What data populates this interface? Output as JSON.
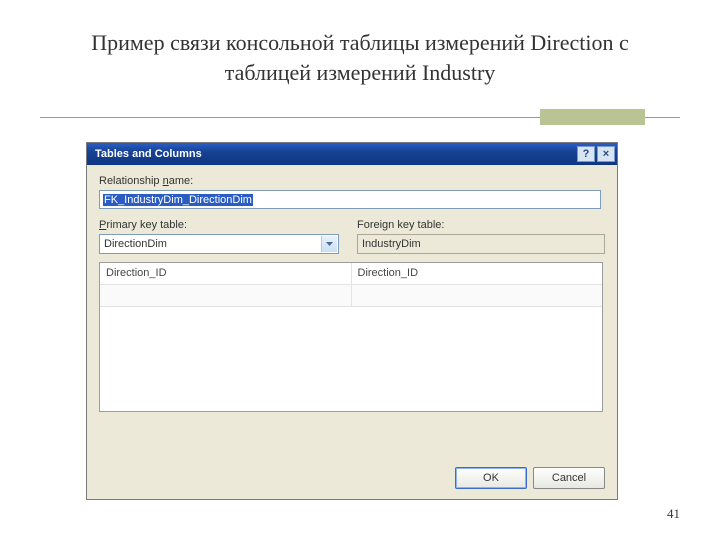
{
  "slide": {
    "title": "Пример связи консольной таблицы измерений Direction c таблицей измерений Industry",
    "page_number": "41"
  },
  "dialog": {
    "title": "Tables and Columns",
    "help_glyph": "?",
    "close_glyph": "×",
    "relationship_label_pre": "Relationship ",
    "relationship_label_ul": "n",
    "relationship_label_post": "ame:",
    "relationship_value": "FK_IndustryDim_DirectionDim",
    "pk_label_ul": "P",
    "pk_label_post": "rimary key table:",
    "pk_value": "DirectionDim",
    "fk_label": "Foreign key table:",
    "fk_value": "IndustryDim",
    "grid": {
      "rows": [
        {
          "left": "Direction_ID",
          "right": "Direction_ID"
        },
        {
          "left": "",
          "right": ""
        }
      ]
    },
    "ok": "OK",
    "cancel": "Cancel"
  }
}
